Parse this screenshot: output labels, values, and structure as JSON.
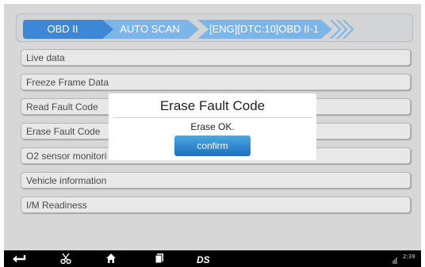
{
  "breadcrumb": [
    {
      "label": "OBD II"
    },
    {
      "label": "AUTO SCAN"
    },
    {
      "label": "[ENG][DTC:10]OBD II-1"
    }
  ],
  "menu": {
    "items": [
      {
        "label": "Live data"
      },
      {
        "label": "Freeze Frame Data"
      },
      {
        "label": "Read Fault Code"
      },
      {
        "label": "Erase Fault Code"
      },
      {
        "label": "O2 sensor monitori"
      },
      {
        "label": "Vehicle information"
      },
      {
        "label": "I/M Readiness"
      }
    ]
  },
  "dialog": {
    "title": "Erase Fault Code",
    "message": "Erase OK.",
    "confirm_label": "confirm"
  },
  "navbar": {
    "icons": [
      "back-icon",
      "scissors-icon",
      "home-icon",
      "recent-apps-icon",
      "ds-logo"
    ],
    "logo_text": "DS",
    "status_icon": "signal-icon",
    "time": "2:39"
  },
  "colors": {
    "crumb_active": "#3d87d6",
    "crumb_inactive": "#7cb6e8",
    "button": "#2a7fd0",
    "background": "#d7d7d7"
  }
}
